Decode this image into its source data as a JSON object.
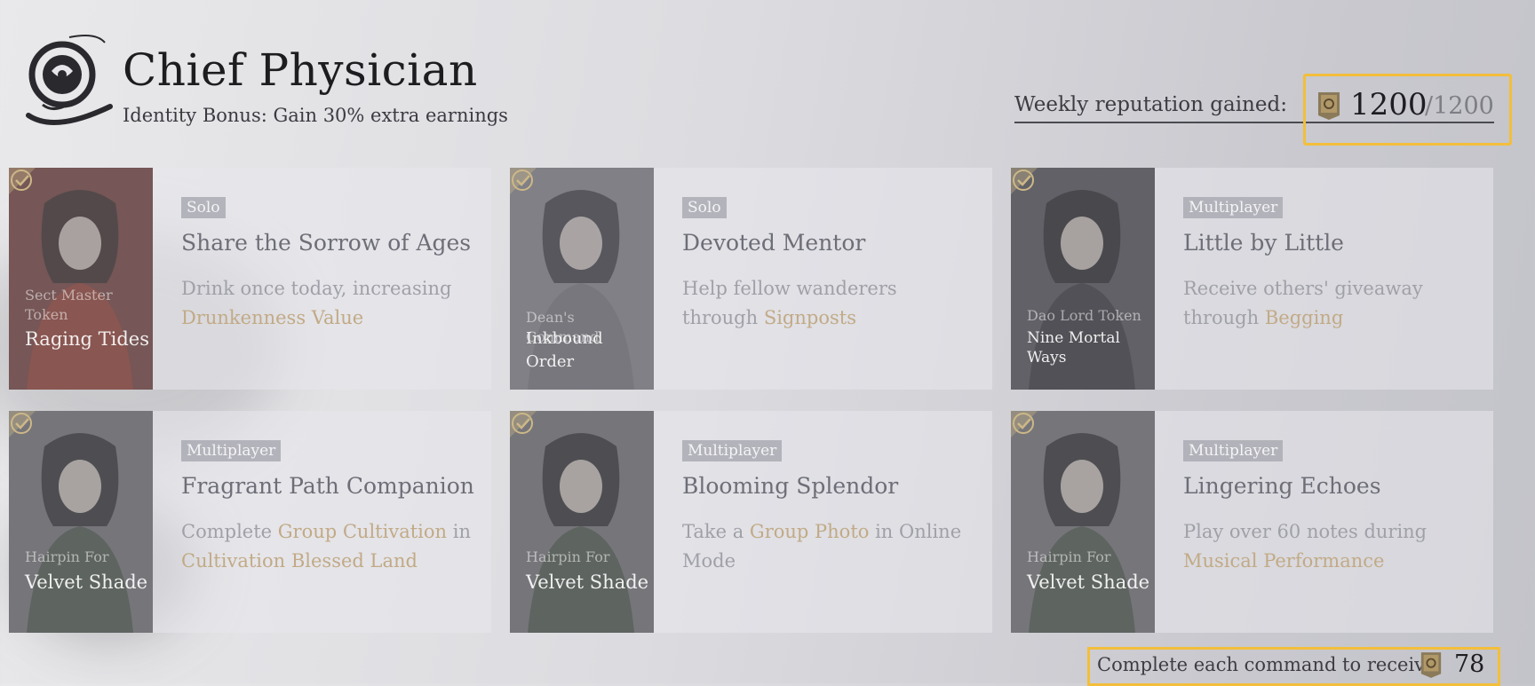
{
  "header": {
    "title": "Chief Physician",
    "subtitle": "Identity Bonus: Gain 30% extra earnings",
    "weekly_label": "Weekly reputation gained:",
    "weekly_value": "1200",
    "weekly_max": "/1200",
    "emblem_icon": "dragon-emblem-icon",
    "reputation_icon": "reputation-token-icon"
  },
  "cards": [
    {
      "completed": true,
      "tag": "Solo",
      "title": "Share the Sorrow of Ages",
      "desc_parts": [
        "Drink once today, increasing ",
        "Drunkenness Value"
      ],
      "token_sub": "Sect Master Token",
      "token_name": "Raging Tides"
    },
    {
      "completed": true,
      "tag": "Solo",
      "title": "Devoted Mentor",
      "desc_parts": [
        "Help fellow wanderers through ",
        "Signposts"
      ],
      "token_sub": "Dean's Command",
      "token_name": "Inkbound Order"
    },
    {
      "completed": true,
      "tag": "Multiplayer",
      "title": "Little by Little",
      "desc_parts": [
        "Receive others' giveaway through ",
        "Begging"
      ],
      "token_sub": "Dao Lord Token",
      "token_name": "Nine Mortal Ways"
    },
    {
      "completed": true,
      "tag": "Multiplayer",
      "title": "Fragrant Path Companion",
      "desc_parts": [
        "Complete ",
        "Group Cultivation",
        " in ",
        "Cultivation Blessed Land"
      ],
      "token_sub": "Hairpin For",
      "token_name": "Velvet Shade"
    },
    {
      "completed": true,
      "tag": "Multiplayer",
      "title": "Blooming Splendor",
      "desc_parts": [
        "Take a ",
        "Group Photo",
        " in Online Mode"
      ],
      "token_sub": "Hairpin For",
      "token_name": "Velvet Shade"
    },
    {
      "completed": true,
      "tag": "Multiplayer",
      "title": "Lingering Echoes",
      "desc_parts": [
        "Play over 60 notes during ",
        "Musical Performance"
      ],
      "token_sub": "Hairpin For",
      "token_name": "Velvet Shade"
    }
  ],
  "footer": {
    "reward_label": "Complete each command to receive:",
    "reward_value": "78"
  },
  "colors": {
    "highlight_box": "#f3be3a",
    "desc_highlight": "#c2aa86"
  }
}
